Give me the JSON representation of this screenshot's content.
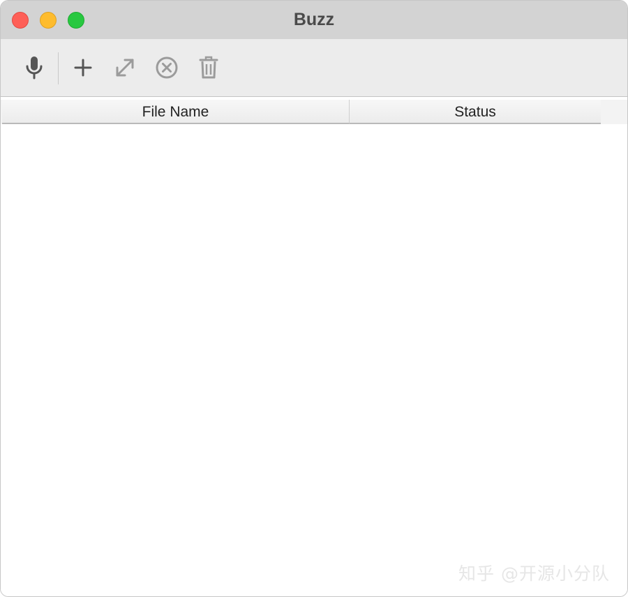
{
  "window": {
    "title": "Buzz"
  },
  "toolbar": {
    "buttons": [
      {
        "name": "record",
        "icon": "microphone-icon",
        "enabled": true
      },
      {
        "name": "add",
        "icon": "plus-icon",
        "enabled": true
      },
      {
        "name": "open-transcript",
        "icon": "expand-arrows-icon",
        "enabled": false
      },
      {
        "name": "stop",
        "icon": "circle-x-icon",
        "enabled": false
      },
      {
        "name": "delete",
        "icon": "trash-icon",
        "enabled": false
      }
    ]
  },
  "table": {
    "columns": [
      "File Name",
      "Status"
    ],
    "rows": []
  },
  "watermark": "知乎 @开源小分队",
  "colors": {
    "titlebar": "#d3d3d3",
    "toolbar": "#ececec",
    "close": "#fe5f57",
    "minimize": "#febc2e",
    "maximize": "#28c840",
    "icon_enabled": "#555555",
    "icon_disabled": "#9b9b9b"
  }
}
